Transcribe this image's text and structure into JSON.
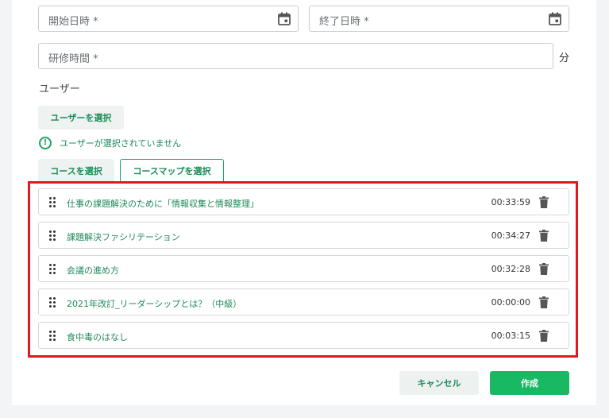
{
  "form": {
    "start_placeholder": "開始日時 *",
    "end_placeholder": "終了日時 *",
    "duration_placeholder": "研修時間 *",
    "duration_unit": "分",
    "users_label": "ユーザー",
    "select_users_button": "ユーザーを選択",
    "no_users_warning": "ユーザーが選択されていません",
    "select_course_button": "コースを選択",
    "select_coursemap_button": "コースマップを選択"
  },
  "courses": [
    {
      "title": "仕事の課題解決のために「情報収集と情報整理」",
      "duration": "00:33:59"
    },
    {
      "title": "課題解決ファシリテーション",
      "duration": "00:34:27"
    },
    {
      "title": "会議の進め方",
      "duration": "00:32:28"
    },
    {
      "title": "2021年改訂_リーダーシップとは？（中級）",
      "duration": "00:00:00"
    },
    {
      "title": "食中毒のはなし",
      "duration": "00:03:15"
    }
  ],
  "actions": {
    "cancel_label": "キャンセル",
    "create_label": "作成"
  },
  "colors": {
    "accent": "#1fa463",
    "primary_button": "#18b962",
    "highlight_border": "#e0191f"
  },
  "icons": [
    "calendar-icon",
    "alert-circle-icon",
    "drag-handle-icon",
    "trash-icon"
  ]
}
